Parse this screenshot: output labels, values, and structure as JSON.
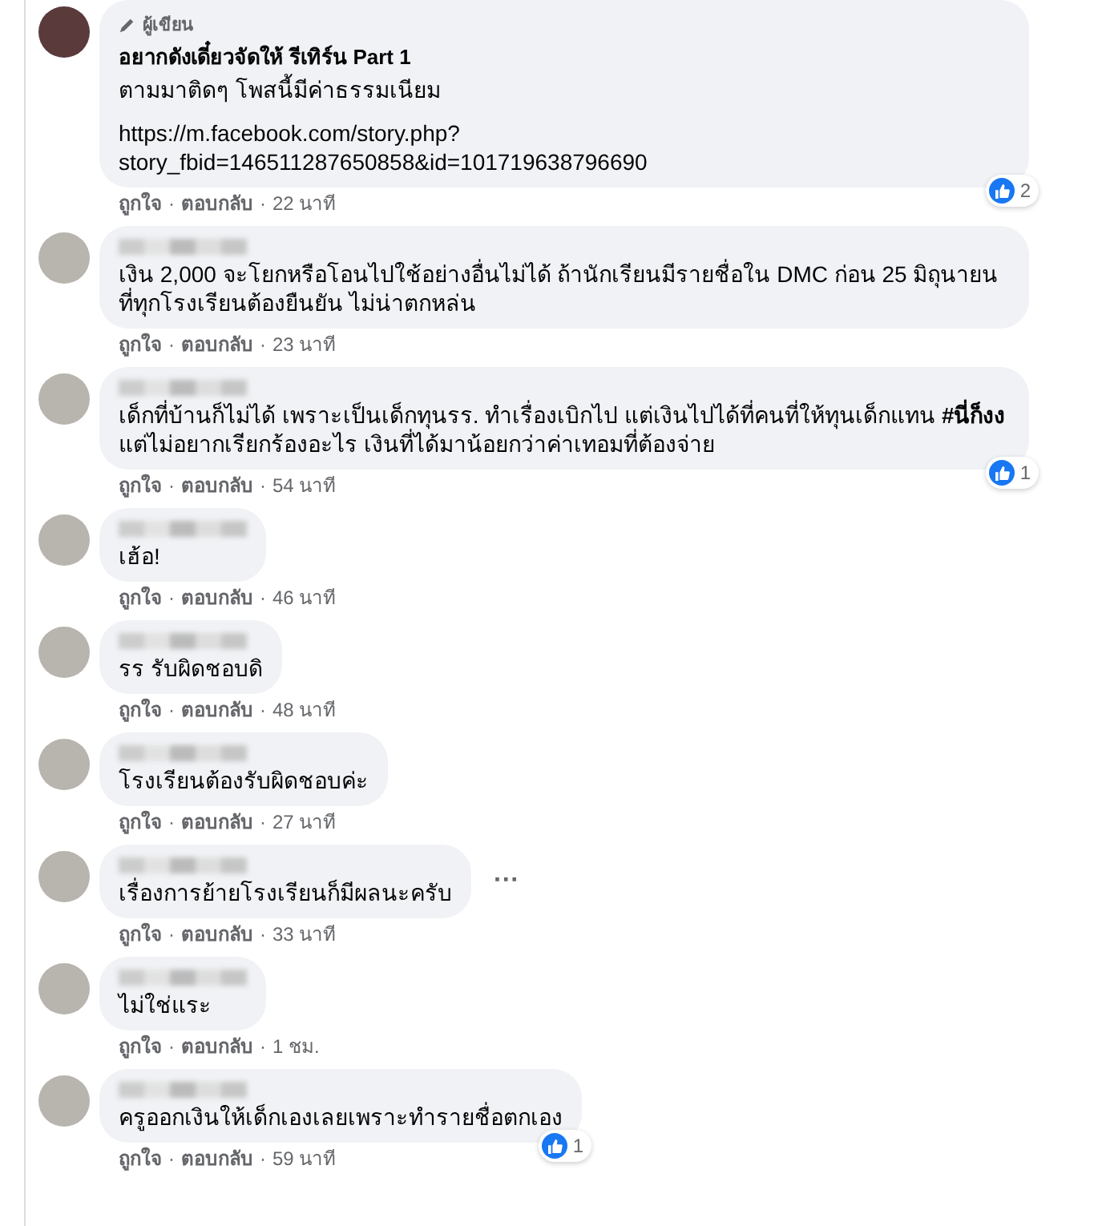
{
  "comments": [
    {
      "badge": "ผู้เขียน",
      "name": "อยากดังเดี๋ยวจัดให้ รีเทิร์น Part 1",
      "text": "ตามมาติดๆ โพสนี้มีค่าธรรมเนียม",
      "link": "https://m.facebook.com/story.php?story_fbid=146511287650858&id=101719638796690",
      "likes": "2",
      "meta": [
        {
          "kind": "action",
          "text": "ถูกใจ"
        },
        {
          "kind": "dot",
          "text": "·"
        },
        {
          "kind": "action",
          "text": "ตอบกลับ"
        },
        {
          "kind": "dot",
          "text": "·"
        },
        {
          "kind": "time",
          "text": "22 นาที"
        }
      ]
    },
    {
      "text": "เงิน 2,000 จะโยกหรือโอนไปใช้อย่างอื่นไม่ได้ ถ้านักเรียนมีรายชื่อใน DMC ก่อน 25 มิถุนายน ที่ทุกโรงเรียนต้องยืนยัน ไม่น่าตกหล่น",
      "meta": [
        {
          "kind": "action",
          "text": "ถูกใจ"
        },
        {
          "kind": "dot",
          "text": "·"
        },
        {
          "kind": "action",
          "text": "ตอบกลับ"
        },
        {
          "kind": "dot",
          "text": "·"
        },
        {
          "kind": "time",
          "text": "23 นาที"
        }
      ]
    },
    {
      "text": "เด็กที่บ้านก็ไม่ได้ เพราะเป็นเด็กทุนรร. ทำเรื่องเบิกไป แต่เงินไปได้ที่คนที่ให้ทุนเด็กแทน **#นี่ก็งง** แต่ไม่อยากเรียกร้องอะไร เงินที่ได้มาน้อยกว่าค่าเทอมที่ต้องจ่าย",
      "likes": "1",
      "meta": [
        {
          "kind": "action",
          "text": "ถูกใจ"
        },
        {
          "kind": "dot",
          "text": "·"
        },
        {
          "kind": "action",
          "text": "ตอบกลับ"
        },
        {
          "kind": "dot",
          "text": "·"
        },
        {
          "kind": "time",
          "text": "54 นาที"
        }
      ]
    },
    {
      "text": "เฮ้อ!",
      "meta": [
        {
          "kind": "action",
          "text": "ถูกใจ"
        },
        {
          "kind": "dot",
          "text": "·"
        },
        {
          "kind": "action",
          "text": "ตอบกลับ"
        },
        {
          "kind": "dot",
          "text": "·"
        },
        {
          "kind": "time",
          "text": "46 นาที"
        }
      ]
    },
    {
      "text": "รร รับผิดชอบดิ",
      "meta": [
        {
          "kind": "action",
          "text": "ถูกใจ"
        },
        {
          "kind": "dot",
          "text": "·"
        },
        {
          "kind": "action",
          "text": "ตอบกลับ"
        },
        {
          "kind": "dot",
          "text": "·"
        },
        {
          "kind": "time",
          "text": "48 นาที"
        }
      ]
    },
    {
      "text": "โรงเรียนต้องรับผิดชอบค่ะ",
      "meta": [
        {
          "kind": "action",
          "text": "ถูกใจ"
        },
        {
          "kind": "dot",
          "text": "·"
        },
        {
          "kind": "action",
          "text": "ตอบกลับ"
        },
        {
          "kind": "dot",
          "text": "·"
        },
        {
          "kind": "time",
          "text": "27 นาที"
        }
      ]
    },
    {
      "text": "เรื่องการย้ายโรงเรียนก็มีผลนะครับ",
      "more": "···",
      "meta": [
        {
          "kind": "action",
          "text": "ถูกใจ"
        },
        {
          "kind": "dot",
          "text": "·"
        },
        {
          "kind": "action",
          "text": "ตอบกลับ"
        },
        {
          "kind": "dot",
          "text": "·"
        },
        {
          "kind": "time",
          "text": "33 นาที"
        }
      ]
    },
    {
      "text": "ไม่ใช่แระ",
      "meta": [
        {
          "kind": "action",
          "text": "ถูกใจ"
        },
        {
          "kind": "dot",
          "text": "·"
        },
        {
          "kind": "action",
          "text": "ตอบกลับ"
        },
        {
          "kind": "dot",
          "text": "·"
        },
        {
          "kind": "time",
          "text": "1 ชม."
        }
      ]
    },
    {
      "text": "ครูออกเงินให้เด็กเองเลยเพราะทำรายชื่อตกเอง",
      "likes": "1",
      "meta": [
        {
          "kind": "action",
          "text": "ถูกใจ"
        },
        {
          "kind": "dot",
          "text": "·"
        },
        {
          "kind": "action",
          "text": "ตอบกลับ"
        },
        {
          "kind": "dot",
          "text": "·"
        },
        {
          "kind": "time",
          "text": "59 นาที"
        }
      ]
    }
  ]
}
